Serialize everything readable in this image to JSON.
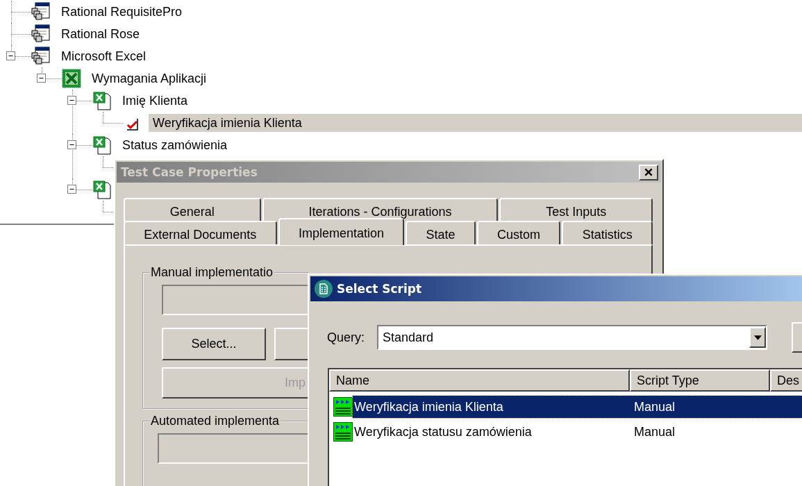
{
  "tree": [
    {
      "kind": "application",
      "label": "Rational RequisitePro",
      "selected": false
    },
    {
      "kind": "application",
      "label": "Rational Rose",
      "selected": false
    },
    {
      "kind": "application",
      "label": "Microsoft Excel",
      "selected": false,
      "expanded": true,
      "children": [
        {
          "kind": "requirement-set",
          "label": "Wymagania Aplikacji",
          "selected": false,
          "expanded": true,
          "children": [
            {
              "kind": "requirement",
              "label": "Imię Klienta",
              "selected": false,
              "expanded": true,
              "children": [
                {
                  "kind": "test-case",
                  "label": "Weryfikacja imienia Klienta",
                  "selected": true
                }
              ]
            },
            {
              "kind": "requirement",
              "label": "Status zamówienia",
              "selected": false,
              "expanded": true,
              "children": [
                {
                  "kind": "hidden"
                }
              ]
            },
            {
              "kind": "requirement",
              "expanded": true,
              "children": [
                {
                  "kind": "hidden"
                }
              ]
            }
          ]
        }
      ]
    }
  ],
  "properties_dialog": {
    "title": "Test Case Properties",
    "tab_rows": [
      [
        {
          "label": "General",
          "selected": false
        },
        {
          "label": "Iterations - Configurations",
          "selected": false
        },
        {
          "label": "Test Inputs",
          "selected": false
        }
      ],
      [
        {
          "label": "External Documents",
          "selected": false
        },
        {
          "label": "Implementation",
          "selected": true
        },
        {
          "label": "State",
          "selected": false
        },
        {
          "label": "Custom",
          "selected": false
        },
        {
          "label": "Statistics",
          "selected": false
        }
      ]
    ],
    "manual_group": {
      "label": "Manual implementatio",
      "select_button": "Select...",
      "implement_button": {
        "label": "Imp",
        "disabled": true
      }
    },
    "automated_group": {
      "label": "Automated implementa"
    }
  },
  "select_script_dialog": {
    "title": "Select Script",
    "query_label": "Query:",
    "query_value": "Standard",
    "columns": [
      "Name",
      "Script Type",
      "Des"
    ],
    "rows": [
      {
        "name": "Weryfikacja imienia Klienta",
        "script_type": "Manual",
        "selected": true
      },
      {
        "name": "Weryfikacja statusu zamówienia",
        "script_type": "Manual",
        "selected": false
      }
    ]
  }
}
